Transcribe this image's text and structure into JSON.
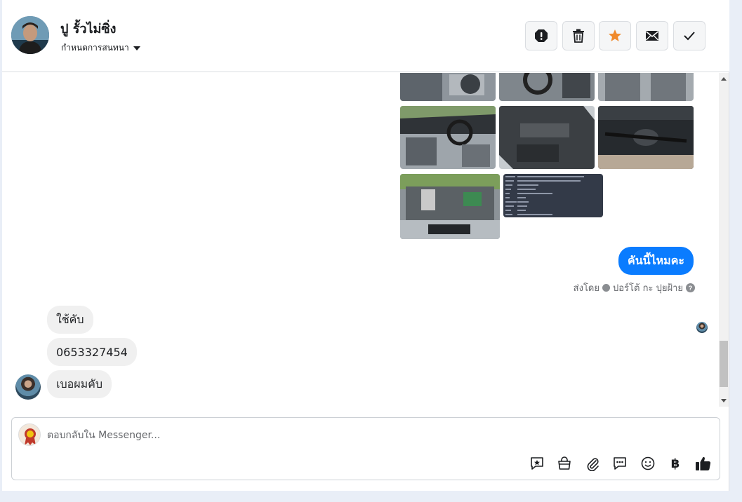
{
  "header": {
    "contact_name": "ปู รั้วไม่ซิ่ง",
    "conversation_settings": "กำหนดการสนทนา"
  },
  "icons": {
    "spam": "exclamation-circle-icon",
    "delete": "trash-icon",
    "star": "star-icon",
    "unread": "envelope-icon",
    "done": "checkmark-icon"
  },
  "colors": {
    "brand_blue": "#0a7cff",
    "star_orange": "#f08a2c"
  },
  "messages": {
    "outgoing_text": "คันนี้ไหมคะ",
    "sent_by_label": "ส่งโดย",
    "sent_by_name": "ปอร์โต้ กะ ปุยฝ้าย",
    "incoming": [
      {
        "text": "ใช้คับ"
      },
      {
        "text": "0653327454"
      },
      {
        "text": "เบอผมคับ"
      }
    ]
  },
  "composer": {
    "placeholder": "ตอบกลับใน Messenger...",
    "tools": [
      "saved-reply-icon",
      "shop-bag-icon",
      "attachment-icon",
      "chat-bubble-icon",
      "emoji-icon",
      "baht-icon",
      "thumbs-up-icon"
    ],
    "baht_symbol": "฿"
  }
}
